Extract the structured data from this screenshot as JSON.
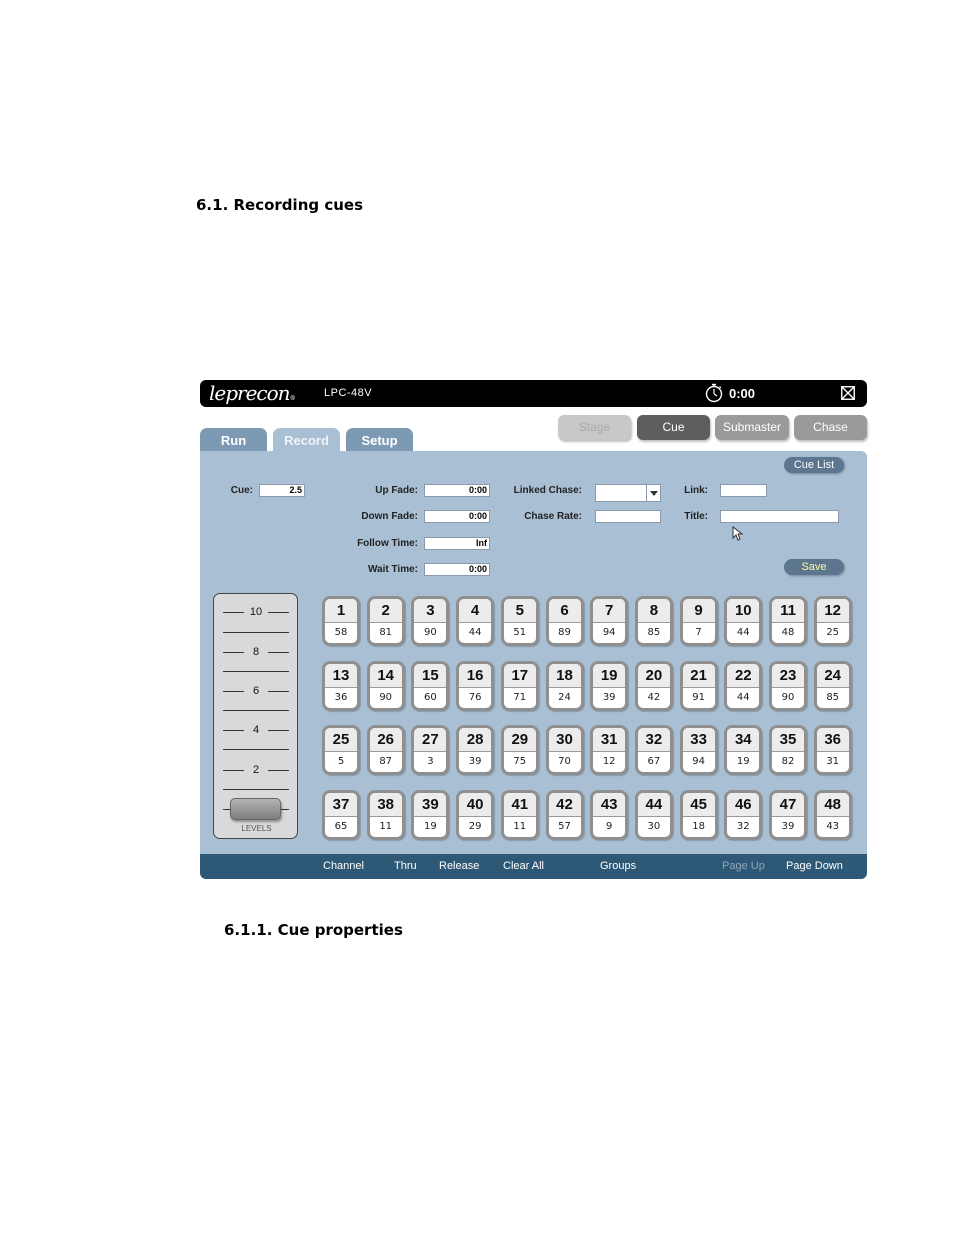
{
  "doc": {
    "heading": "6.1. Recording cues",
    "subheading": "6.1.1. Cue properties"
  },
  "app": {
    "logo": "leprecon",
    "logo_reg": "®",
    "model": "LPC-48V",
    "timer_icon": "stopwatch-icon",
    "timer": "0:00",
    "close_icon": "close-icon"
  },
  "modes": [
    {
      "label": "Stage",
      "state": "disabled"
    },
    {
      "label": "Cue",
      "state": "active"
    },
    {
      "label": "Submaster",
      "state": "normal"
    },
    {
      "label": "Chase",
      "state": "normal"
    }
  ],
  "tabs": [
    {
      "label": "Run"
    },
    {
      "label": "Record",
      "active": true
    },
    {
      "label": "Setup"
    }
  ],
  "form": {
    "cue_label": "Cue:",
    "cue_value": "2.5",
    "up_fade_label": "Up Fade:",
    "up_fade_value": "0:00",
    "down_fade_label": "Down Fade:",
    "down_fade_value": "0:00",
    "follow_time_label": "Follow Time:",
    "follow_time_value": "Inf",
    "wait_time_label": "Wait Time:",
    "wait_time_value": "0:00",
    "linked_chase_label": "Linked Chase:",
    "linked_chase_value": "",
    "chase_rate_label": "Chase Rate:",
    "chase_rate_value": "",
    "link_label": "Link:",
    "link_value": "",
    "title_label": "Title:",
    "title_value": "",
    "cue_list_button": "Cue List",
    "save_button": "Save"
  },
  "levels": {
    "label": "LEVELS",
    "scale": [
      "10",
      "8",
      "6",
      "4",
      "2"
    ],
    "fader_value": 0
  },
  "channels": [
    {
      "ch": "1",
      "level": "58"
    },
    {
      "ch": "2",
      "level": "81"
    },
    {
      "ch": "3",
      "level": "90"
    },
    {
      "ch": "4",
      "level": "44"
    },
    {
      "ch": "5",
      "level": "51"
    },
    {
      "ch": "6",
      "level": "89"
    },
    {
      "ch": "7",
      "level": "94"
    },
    {
      "ch": "8",
      "level": "85"
    },
    {
      "ch": "9",
      "level": "7"
    },
    {
      "ch": "10",
      "level": "44"
    },
    {
      "ch": "11",
      "level": "48"
    },
    {
      "ch": "12",
      "level": "25"
    },
    {
      "ch": "13",
      "level": "36"
    },
    {
      "ch": "14",
      "level": "90"
    },
    {
      "ch": "15",
      "level": "60"
    },
    {
      "ch": "16",
      "level": "76"
    },
    {
      "ch": "17",
      "level": "71"
    },
    {
      "ch": "18",
      "level": "24"
    },
    {
      "ch": "19",
      "level": "39"
    },
    {
      "ch": "20",
      "level": "42"
    },
    {
      "ch": "21",
      "level": "91"
    },
    {
      "ch": "22",
      "level": "44"
    },
    {
      "ch": "23",
      "level": "90"
    },
    {
      "ch": "24",
      "level": "85"
    },
    {
      "ch": "25",
      "level": "5"
    },
    {
      "ch": "26",
      "level": "87"
    },
    {
      "ch": "27",
      "level": "3"
    },
    {
      "ch": "28",
      "level": "39"
    },
    {
      "ch": "29",
      "level": "75"
    },
    {
      "ch": "30",
      "level": "70"
    },
    {
      "ch": "31",
      "level": "12"
    },
    {
      "ch": "32",
      "level": "67"
    },
    {
      "ch": "33",
      "level": "94"
    },
    {
      "ch": "34",
      "level": "19"
    },
    {
      "ch": "35",
      "level": "82"
    },
    {
      "ch": "36",
      "level": "31"
    },
    {
      "ch": "37",
      "level": "65"
    },
    {
      "ch": "38",
      "level": "11"
    },
    {
      "ch": "39",
      "level": "19"
    },
    {
      "ch": "40",
      "level": "29"
    },
    {
      "ch": "41",
      "level": "11"
    },
    {
      "ch": "42",
      "level": "57"
    },
    {
      "ch": "43",
      "level": "9"
    },
    {
      "ch": "44",
      "level": "30"
    },
    {
      "ch": "45",
      "level": "18"
    },
    {
      "ch": "46",
      "level": "32"
    },
    {
      "ch": "47",
      "level": "39"
    },
    {
      "ch": "48",
      "level": "43"
    }
  ],
  "bottombar": [
    {
      "label": "Channel",
      "enabled": true
    },
    {
      "label": "Thru",
      "enabled": true
    },
    {
      "label": "Release",
      "enabled": true
    },
    {
      "label": "Clear All",
      "enabled": true
    },
    {
      "label": "Groups",
      "enabled": true
    },
    {
      "label": "Page Up",
      "enabled": false
    },
    {
      "label": "Page Down",
      "enabled": true
    }
  ],
  "colors": {
    "panel": "#a9bfd3",
    "bottombar": "#2d5977",
    "tab_inactive": "#7d9ab4",
    "mode_active": "#5e5e5e",
    "save_text": "#ffff99"
  }
}
